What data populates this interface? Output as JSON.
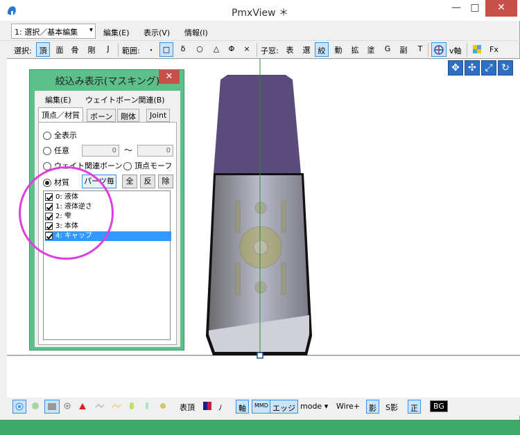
{
  "window": {
    "title": "PmxView ＊",
    "min": "—",
    "max": "□",
    "close": "✕"
  },
  "menubar": {
    "mode_select": "1: 選択／基本編集",
    "items": [
      "編集(E)",
      "表示(V)",
      "情報(I)"
    ]
  },
  "toolbar": {
    "select_label": "選択:",
    "select_items": [
      "頂",
      "面",
      "骨",
      "剛",
      "J"
    ],
    "range_label": "範囲:",
    "range_items": [
      "・",
      "□",
      "δ",
      "○",
      "△",
      "Φ",
      "×"
    ],
    "child_label": "子窓:",
    "child_items": [
      "表",
      "選",
      "絞",
      "動",
      "拡",
      "塗",
      "G",
      "副",
      "T"
    ],
    "axis_label": "v軸",
    "fx_label": "Fx"
  },
  "bottombar": {
    "table_label": "表頂",
    "no_label": "ﾉ",
    "axis_label": "軸",
    "mmd_label": "MMD",
    "edge_label": "エッジ",
    "mode_label": "mode",
    "wire_label": "Wire+",
    "shadow_label": "影",
    "sshadow_label": "S影",
    "front_label": "正",
    "bg_label": "BG"
  },
  "dialog": {
    "title": "絞込み表示(マスキング)",
    "menu": [
      "編集(E)",
      "ウェイトボーン関連(B)"
    ],
    "tabs": [
      "頂点／材質",
      "ボーン",
      "剛体",
      "Joint"
    ],
    "radios": {
      "all": "全表示",
      "any": "任意",
      "weight": "ウェイト関連ボーン",
      "vmorph": "頂点モーフ",
      "material": "材質"
    },
    "range_from": "0",
    "range_tilde": "〜",
    "range_to": "0",
    "parts_btn": "パーツ毎",
    "all_btn": "全",
    "invert_btn": "反",
    "remove_btn": "除",
    "materials": [
      "0: 液体",
      "1: 液体逆さ",
      "2: 雫",
      "3: 本体",
      "4: キャップ"
    ]
  }
}
